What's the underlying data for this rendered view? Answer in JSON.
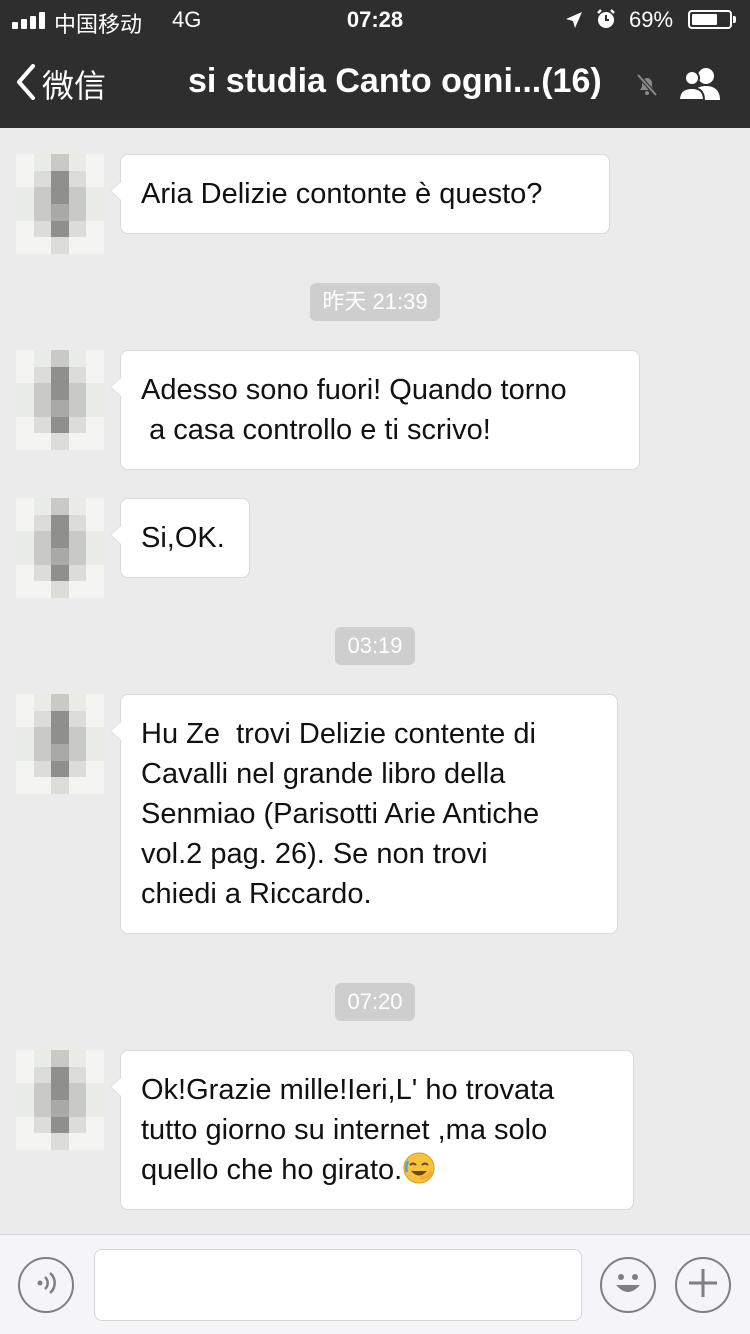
{
  "status_bar": {
    "carrier": "中国移动",
    "network": "4G",
    "time": "07:28",
    "battery": "69%",
    "battery_level": 0.69
  },
  "nav": {
    "back_label": "微信",
    "title": "si studia Canto ogni...(16)"
  },
  "messages": [
    {
      "type": "message",
      "text": "Aria Delizie contonte è questo?"
    },
    {
      "type": "timestamp",
      "text": "昨天 21:39"
    },
    {
      "type": "message",
      "text": "Adesso sono fuori! Quando torno\n a casa controllo e ti scrivo!"
    },
    {
      "type": "message",
      "text": "Si,OK."
    },
    {
      "type": "timestamp",
      "text": "03:19"
    },
    {
      "type": "message",
      "text": "Hu Ze  trovi Delizie contente di\nCavalli nel grande libro della\nSenmiao (Parisotti Arie Antiche\nvol.2 pag. 26). Se non trovi\nchiedi a Riccardo."
    },
    {
      "type": "timestamp",
      "text": "07:20"
    },
    {
      "type": "message",
      "text": "Ok!Grazie mille!Ieri,L' ho trovata\ntutto giorno su internet ,ma solo\nquello che ho girato.",
      "emoji": "face-palm-laughing-icon"
    }
  ],
  "input": {
    "value": "",
    "placeholder": ""
  },
  "colors": {
    "header": "#2e2e2e",
    "chat_background": "#ebebeb",
    "bubble": "#ffffff",
    "timestamp_pill": "#cecece"
  }
}
